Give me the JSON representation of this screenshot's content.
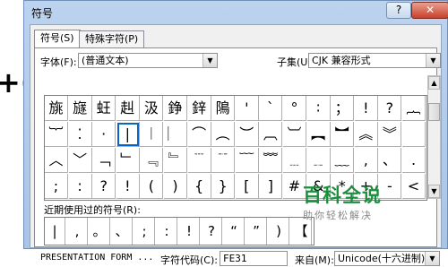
{
  "edge_glyph": "+(",
  "window": {
    "title": "符号",
    "help_button": "?",
    "close_button": "✕"
  },
  "tabs": [
    {
      "label": "符号(S)"
    },
    {
      "label": "特殊字符(P)"
    }
  ],
  "font": {
    "label": "字体(F):",
    "value": "(普通文本)"
  },
  "subset": {
    "label": "子集(U):",
    "value": "CJK 兼容形式"
  },
  "symbols": [
    [
      "旐",
      "旞",
      "蚟",
      "赳",
      "汲",
      "錚",
      "鋅",
      "隝",
      "'",
      "`",
      "°",
      "∶",
      "；",
      "!",
      "?",
      "︷"
    ],
    [
      "︸",
      "⁚",
      "·",
      "|",
      "︱",
      "︳",
      "⌒",
      "︵",
      "︶",
      "︹",
      "︺",
      "︻",
      "︼",
      "︽",
      "︾",
      ""
    ],
    [
      "︿",
      "﹀",
      "﹁",
      "﹂",
      "﹃",
      "﹄",
      "﹉",
      "﹊",
      "﹋",
      "﹌",
      "﹍",
      "﹎",
      "﹏",
      ",",
      "、",
      "."
    ],
    [
      ";",
      ":",
      "?",
      "!",
      "(",
      ")",
      "{",
      "}",
      "[",
      "]",
      "#",
      "&",
      "*",
      "+",
      "-",
      "<"
    ]
  ],
  "selected": {
    "row": 1,
    "col": 3
  },
  "recent": {
    "label": "近期使用过的符号(R):",
    "symbols": [
      "|",
      ",",
      "。",
      "、",
      ";",
      ":",
      "!",
      "?",
      "“",
      "”",
      ")",
      "【"
    ]
  },
  "bottom": {
    "char_name": "PRESENTATION FORM ...",
    "code_label": "字符代码(C):",
    "code_value": "FE31",
    "from_label": "来自(M):",
    "from_value": "Unicode(十六进制)"
  },
  "watermark": {
    "title": "百科全说",
    "subtitle": "助你轻松解决"
  }
}
